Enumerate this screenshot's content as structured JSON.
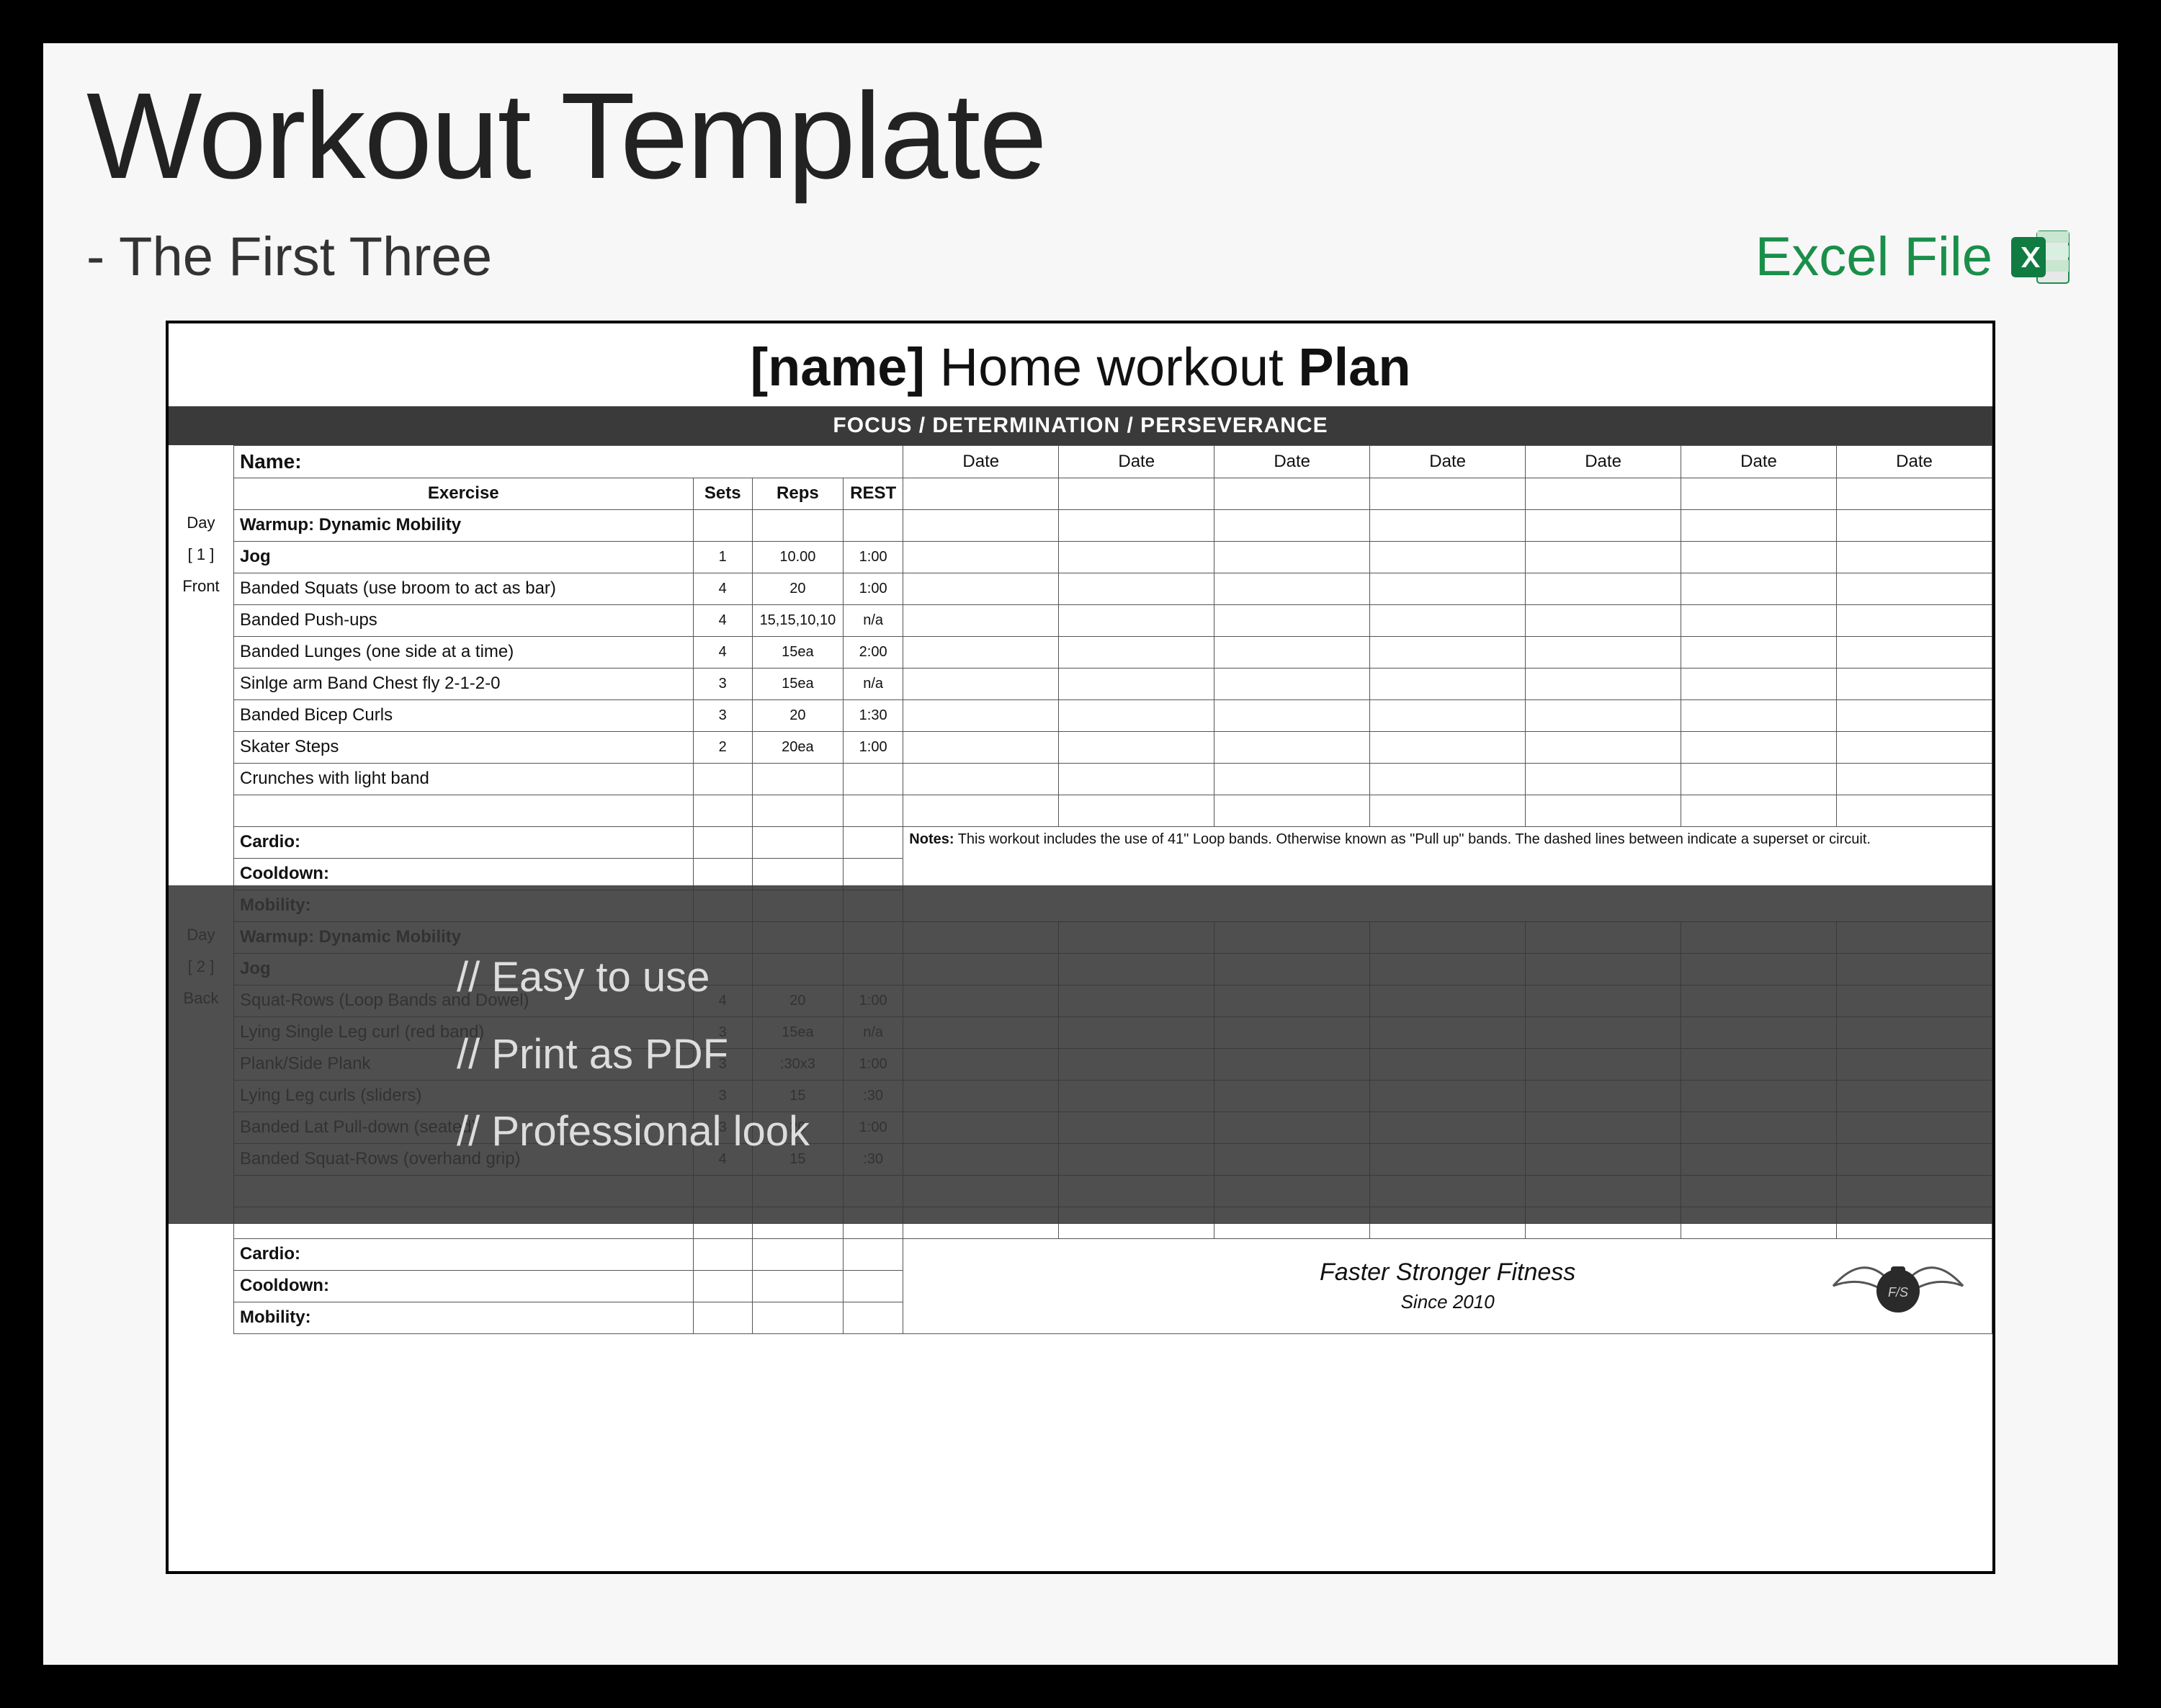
{
  "hero": {
    "title": "Workout Template",
    "subtitle": "- The First Three",
    "excel_label": "Excel File"
  },
  "plan": {
    "title_prefix": "[name]",
    "title_mid": " Home workout ",
    "title_suffix": "Plan",
    "motto": "FOCUS     /     DETERMINATION     /     PERSEVERANCE",
    "name_label": "Name:",
    "headers": {
      "exercise": "Exercise",
      "sets": "Sets",
      "reps": "Reps",
      "rest": "REST",
      "date": "Date"
    },
    "side": {
      "day1a": "Day",
      "day1b": "[ 1 ]",
      "day1c": "Front",
      "day2a": "Day",
      "day2b": "[ 2 ]",
      "day2c": "Back"
    },
    "notes_label": "Notes:",
    "notes_text": " This workout includes the use of 41\" Loop bands. Otherwise known as \"Pull up\" bands. The dashed lines between indicate a superset or circuit.",
    "brand_line1": "Faster Stronger Fitness",
    "brand_line2": "Since 2010"
  },
  "day1": [
    {
      "name": "Warmup: Dynamic Mobility",
      "cls": "red",
      "sets": "",
      "reps": "",
      "rest": ""
    },
    {
      "name": "Jog",
      "cls": "red",
      "sets": "1",
      "reps": "10.00",
      "rest": "1:00",
      "redsr": true
    },
    {
      "name": "Banded Squats (use broom to act as bar)",
      "sets": "4",
      "reps": "20",
      "rest": "1:00"
    },
    {
      "name": "Banded Push-ups",
      "sets": "4",
      "reps": "15,15,10,10",
      "rest": "n/a",
      "dash": true
    },
    {
      "name": "Banded Lunges (one side at a time)",
      "sets": "4",
      "reps": "15ea",
      "rest": "2:00"
    },
    {
      "name": "Sinlge arm Band Chest fly 2-1-2-0",
      "sets": "3",
      "reps": "15ea",
      "rest": "n/a",
      "dash": true
    },
    {
      "name": "Banded Bicep Curls",
      "sets": "3",
      "reps": "20",
      "rest": "1:30",
      "dash": true
    },
    {
      "name": "Skater Steps",
      "sets": "2",
      "reps": "20ea",
      "rest": "1:00"
    },
    {
      "name": "Crunches with light band",
      "sets": "",
      "reps": "",
      "rest": ""
    },
    {
      "name": "",
      "sets": "",
      "reps": "",
      "rest": ""
    }
  ],
  "day1_end": [
    {
      "name": "Cardio:",
      "cls": "red"
    },
    {
      "name": "Cooldown:",
      "cls": "blue"
    },
    {
      "name": "Mobility:",
      "cls": "blue"
    }
  ],
  "day2": [
    {
      "name": "Warmup: Dynamic Mobility",
      "cls": "red",
      "sets": "",
      "reps": "",
      "rest": ""
    },
    {
      "name": "Jog",
      "cls": "red",
      "sets": "",
      "reps": "",
      "rest": "",
      "redsr": true
    },
    {
      "name": "Squat-Rows (Loop Bands and Dowel)",
      "sets": "4",
      "reps": "20",
      "rest": "1:00"
    },
    {
      "name": "Lying Single Leg curl (red band)",
      "sets": "3",
      "reps": "15ea",
      "rest": "n/a"
    },
    {
      "name": "Plank/Side Plank",
      "sets": "3",
      "reps": ":30x3",
      "rest": "1:00"
    },
    {
      "name": "Lying Leg curls (sliders)",
      "sets": "3",
      "reps": "15",
      "rest": ":30"
    },
    {
      "name": "Banded Lat Pull-down (seated)",
      "sets": "3",
      "reps": "20",
      "rest": "1:00"
    },
    {
      "name": "Banded Squat-Rows (overhand grip)",
      "sets": "4",
      "reps": "15",
      "rest": ":30"
    },
    {
      "name": "",
      "sets": "",
      "reps": "",
      "rest": ""
    },
    {
      "name": "",
      "sets": "",
      "reps": "",
      "rest": ""
    }
  ],
  "day2_end": [
    {
      "name": "Cardio:",
      "cls": "red"
    },
    {
      "name": "Cooldown:",
      "cls": "blue"
    },
    {
      "name": "Mobility:",
      "cls": "blue"
    }
  ],
  "overlay": {
    "l1": "// Easy to use",
    "l2": "// Print as PDF",
    "l3": "// Professional look"
  }
}
